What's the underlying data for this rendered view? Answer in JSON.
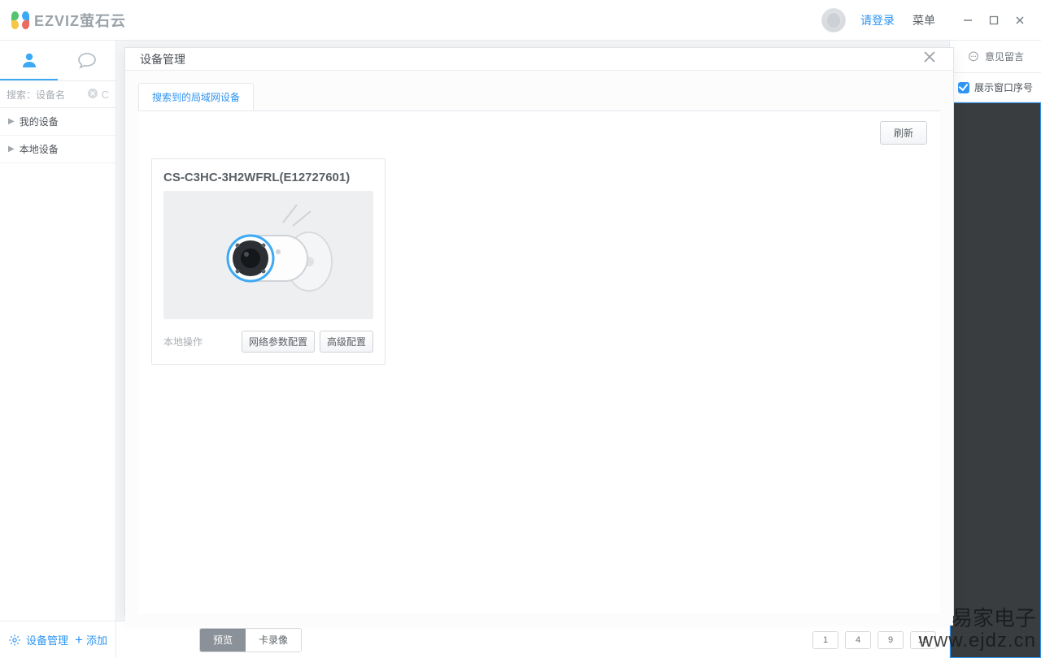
{
  "brand": "EZVIZ萤石云",
  "titlebar": {
    "login": "请登录",
    "menu": "菜单"
  },
  "sidebar": {
    "search_placeholder": "搜索：设备名",
    "tree": [
      "我的设备",
      "本地设备"
    ],
    "device_mgmt": "设备管理",
    "add": "添加"
  },
  "modal": {
    "title": "设备管理",
    "tab": "搜索到的局域网设备",
    "refresh": "刷新",
    "device": {
      "name": "CS-C3HC-3H2WFRL(E12727601)",
      "local_ops": "本地操作",
      "net_cfg": "网络参数配置",
      "adv_cfg": "高级配置"
    }
  },
  "right": {
    "feedback": "意见留言",
    "show_index": "展示窗口序号"
  },
  "bottombar": {
    "preview": "预览",
    "record": "卡录像",
    "grids": [
      "1",
      "4",
      "9",
      "16"
    ]
  },
  "watermark": {
    "line1": "易家电子",
    "line2": "www.ejdz.cn"
  }
}
